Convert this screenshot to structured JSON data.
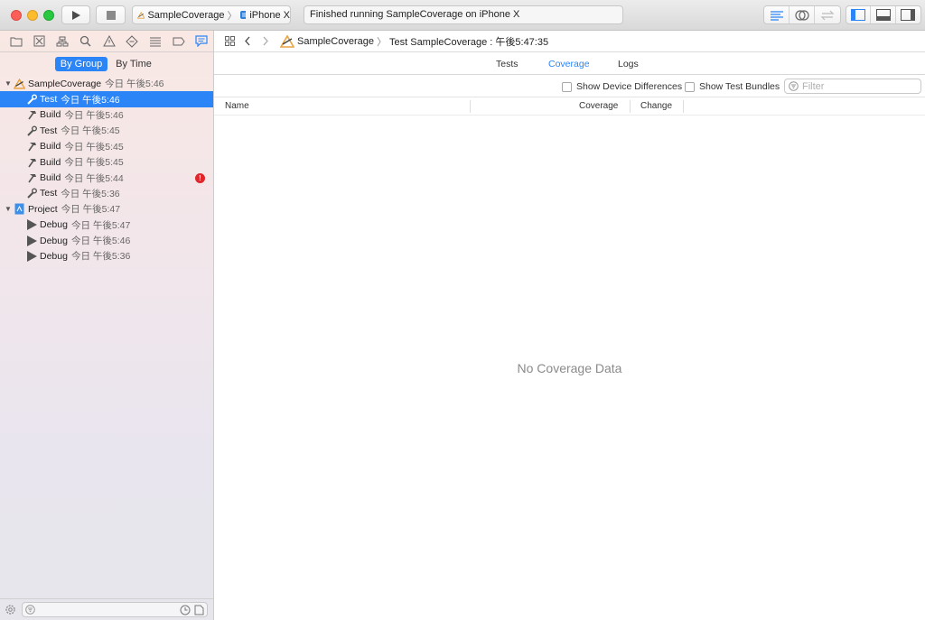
{
  "toolbar": {
    "scheme_name": "SampleCoverage",
    "device_name": "iPhone X",
    "activity_text": "Finished running SampleCoverage on iPhone X"
  },
  "navigator": {
    "segments": {
      "by_group": "By Group",
      "by_time": "By Time",
      "selected": "by_group"
    },
    "groups": [
      {
        "name": "SampleCoverage",
        "time": "今日 午後5:46",
        "items": [
          {
            "icon": "wrench-icon",
            "name": "Test",
            "time": "今日 午後5:46",
            "selected": true
          },
          {
            "icon": "hammer-icon",
            "name": "Build",
            "time": "今日 午後5:46"
          },
          {
            "icon": "wrench-icon",
            "name": "Test",
            "time": "今日 午後5:45"
          },
          {
            "icon": "hammer-icon",
            "name": "Build",
            "time": "今日 午後5:45"
          },
          {
            "icon": "hammer-icon",
            "name": "Build",
            "time": "今日 午後5:45"
          },
          {
            "icon": "hammer-icon",
            "name": "Build",
            "time": "今日 午後5:44",
            "error": "!"
          },
          {
            "icon": "wrench-icon",
            "name": "Test",
            "time": "今日 午後5:36"
          }
        ]
      },
      {
        "name": "Project",
        "time": "今日 午後5:47",
        "items": [
          {
            "icon": "play-icon",
            "name": "Debug",
            "time": "今日 午後5:47"
          },
          {
            "icon": "play-icon",
            "name": "Debug",
            "time": "今日 午後5:46"
          },
          {
            "icon": "play-icon",
            "name": "Debug",
            "time": "今日 午後5:36"
          }
        ]
      }
    ]
  },
  "editor": {
    "breadcrumb": {
      "project": "SampleCoverage",
      "report": "Test SampleCoverage : 午後5:47:35"
    },
    "tabs": {
      "tests": "Tests",
      "coverage": "Coverage",
      "logs": "Logs",
      "active": "coverage"
    },
    "options": {
      "show_device_differences": "Show Device Differences",
      "show_test_bundles": "Show Test Bundles",
      "filter_placeholder": "Filter"
    },
    "columns": {
      "name": "Name",
      "coverage": "Coverage",
      "change": "Change"
    },
    "empty_message": "No Coverage Data"
  },
  "colors": {
    "accent": "#2b85f7",
    "error": "#e0262b"
  }
}
